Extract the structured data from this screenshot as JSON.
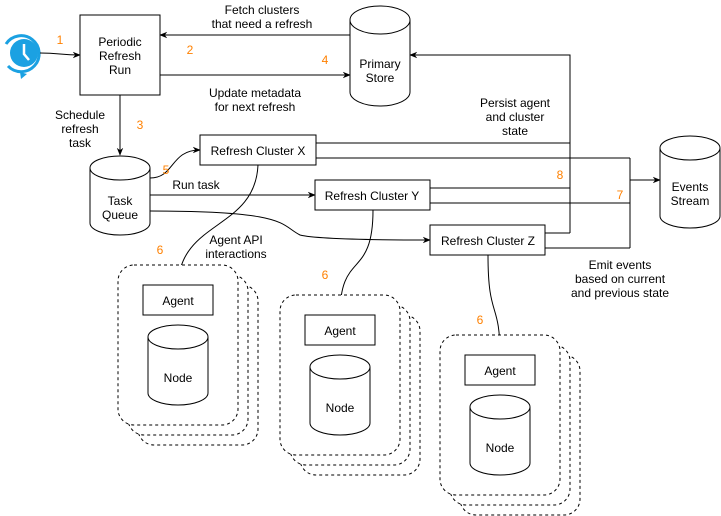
{
  "nodes": {
    "periodic": [
      "Periodic",
      "Refresh",
      "Run"
    ],
    "primary_store": [
      "Primary",
      "Store"
    ],
    "task_queue": [
      "Task",
      "Queue"
    ],
    "events_stream": [
      "Events",
      "Stream"
    ],
    "cluster_x": "Refresh Cluster X",
    "cluster_y": "Refresh Cluster Y",
    "cluster_z": "Refresh Cluster Z",
    "agent": "Agent",
    "node": "Node"
  },
  "labels": {
    "fetch": [
      "Fetch clusters",
      "that need a refresh"
    ],
    "update": [
      "Update metadata",
      "for next refresh"
    ],
    "schedule": [
      "Schedule",
      "refresh",
      "task"
    ],
    "run_task": "Run task",
    "agent_api": [
      "Agent API",
      "interactions"
    ],
    "persist": [
      "Persist agent",
      "and cluster",
      "state"
    ],
    "emit": [
      "Emit events",
      "based on current",
      "and previous state"
    ]
  },
  "steps": [
    "1",
    "2",
    "3",
    "4",
    "5",
    "6",
    "7",
    "8"
  ],
  "icons": {
    "trigger": "clock-refresh-icon"
  },
  "colors": {
    "step_numbers": "#FF8000",
    "clock": "#1BA1E2"
  }
}
